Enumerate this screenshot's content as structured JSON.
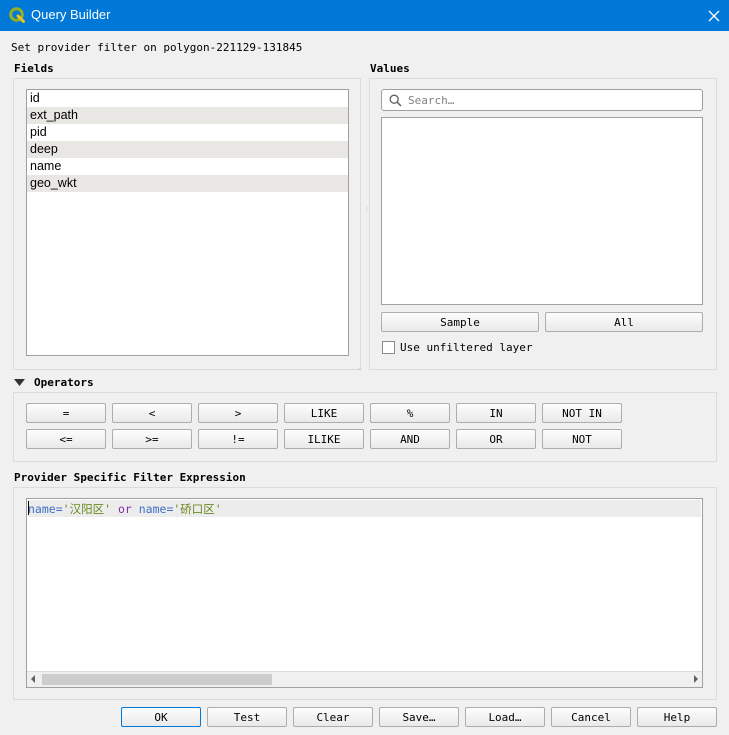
{
  "window": {
    "title": "Query Builder"
  },
  "subtitle": "Set provider filter on polygon-221129-131845",
  "fields": {
    "label": "Fields",
    "items": [
      "id",
      "ext_path",
      "pid",
      "deep",
      "name",
      "geo_wkt"
    ]
  },
  "values": {
    "label": "Values",
    "search_placeholder": "Search…",
    "sample_label": "Sample",
    "all_label": "All",
    "unfiltered_label": "Use unfiltered layer",
    "unfiltered_checked": false
  },
  "operators": {
    "label": "Operators",
    "row1": [
      "=",
      "<",
      ">",
      "LIKE",
      "%",
      "IN",
      "NOT IN"
    ],
    "row2": [
      "<=",
      ">=",
      "!=",
      "ILIKE",
      "AND",
      "OR",
      "NOT"
    ]
  },
  "filter": {
    "label": "Provider Specific Filter Expression",
    "expression_parts": {
      "f1": "name",
      "eq1": "=",
      "v1": "'汉阳区'",
      "op": "or",
      "f2": "name",
      "eq2": "=",
      "v2": "'硚口区'"
    }
  },
  "buttons": {
    "ok": "OK",
    "test": "Test",
    "clear": "Clear",
    "save": "Save…",
    "load": "Load…",
    "cancel": "Cancel",
    "help": "Help"
  },
  "colors": {
    "titlebar": "#0078d7",
    "field_token": "#3f6ec6",
    "string_token": "#6a8a1f",
    "keyword_token": "#7e2fa0"
  }
}
